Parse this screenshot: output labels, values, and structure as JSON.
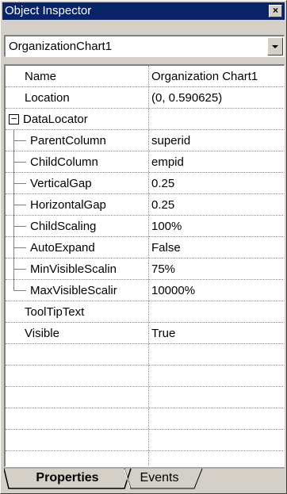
{
  "window": {
    "title": "Object Inspector",
    "close_label": "×"
  },
  "object_selector": {
    "value": "OrganizationChart1"
  },
  "properties": [
    {
      "name": "Name",
      "value": "Organization Chart1",
      "level": 0
    },
    {
      "name": "Location",
      "value": "(0, 0.590625)",
      "level": 0
    },
    {
      "name": "DataLocator",
      "value": "",
      "level": 0,
      "expanded": true
    },
    {
      "name": "ParentColumn",
      "value": "superid",
      "level": 1
    },
    {
      "name": "ChildColumn",
      "value": "empid",
      "level": 1
    },
    {
      "name": "VerticalGap",
      "value": "0.25",
      "level": 1
    },
    {
      "name": "HorizontalGap",
      "value": "0.25",
      "level": 1
    },
    {
      "name": "ChildScaling",
      "value": "100%",
      "level": 1
    },
    {
      "name": "AutoExpand",
      "value": "False",
      "level": 1
    },
    {
      "name": "MinVisibleScalin",
      "value": "75%",
      "level": 1
    },
    {
      "name": "MaxVisibleScalir",
      "value": "10000%",
      "level": 1
    },
    {
      "name": "ToolTipText",
      "value": "",
      "level": 0
    },
    {
      "name": "Visible",
      "value": "True",
      "level": 0
    }
  ],
  "tabs": [
    {
      "label": "Properties",
      "active": true
    },
    {
      "label": "Events",
      "active": false
    }
  ]
}
